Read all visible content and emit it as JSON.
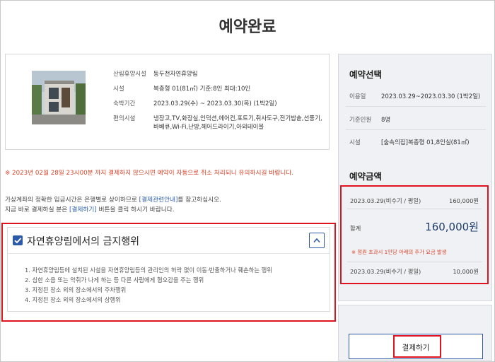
{
  "page": {
    "title": "예약완료"
  },
  "facility": {
    "photo_icon": "house-photo",
    "rows": [
      {
        "label": "산림휴양시설",
        "value": "동두천자연휴양림"
      },
      {
        "label": "시설",
        "value": "복층형 01(81㎡) 기준:8인 최대:10인"
      },
      {
        "label": "숙박기간",
        "value": "2023.03.29(수) ~ 2023.03.30(목) (1박2일)"
      },
      {
        "label": "편의시설",
        "value": "냉장고,TV,화장실,인덕션,에어컨,포트기,취사도구,전기밥솥,선풍기,바베큐,Wi-Fi,난방,헤어드라이기,아외테이블"
      }
    ]
  },
  "notice": {
    "deadline": "※ 2023년 02월 28일 23시00분 까지 결제하지 않으시면 예약이 자동으로 취소 처리되니 유의하시길 바랍니다.",
    "line1_pre": "가상계좌의 정확한 입금시간은 은행별로 상이하므로 ",
    "line1_link": "[결제관련안내]",
    "line1_post": "를 참고하십시오.",
    "line2_pre": "지금 바로 결제하실 분은 ",
    "line2_link": "[결제하기]",
    "line2_post": " 버튼을 클릭 하시기 바랍니다."
  },
  "prohibited": {
    "title": "자연휴양림에서의 금지행위",
    "items": [
      "1. 자연휴양림등에 설치된 시설을 자연휴양림등의 관리인의 허락 없이 이동·반출하거나 훼손하는 행위",
      "2. 심한 소음 또는 악취가 나게 하는 등 다른 사람에게 혐오감을 주는 행위",
      "3. 지정된 장소 외의 장소에서의 주차행위",
      "4. 지정된 장소 외의 장소에서의 상행위"
    ]
  },
  "selection": {
    "title": "예약선택",
    "rows": [
      {
        "label": "이용일",
        "value": "2023.03.29~2023.03.30 (1박2일)"
      },
      {
        "label": "기준인원",
        "value": "8명"
      },
      {
        "label": "시설",
        "value": "[숲속의집]복층형 01,8인실(81㎡)"
      }
    ]
  },
  "amount": {
    "title": "예약금액",
    "line1_date": "2023.03.29(비수기 / 평일)",
    "line1_price": "160,000원",
    "total_label": "합계",
    "total_value": "160,000원",
    "surcharge_note": "※ 정원 초과시 1인당 아래의 추가 요금 발생",
    "extra_date": "2023.03.29(비수기 / 평일)",
    "extra_price": "10,000원"
  },
  "actions": {
    "pay_label": "결제하기"
  },
  "colors": {
    "accent": "#2d5aa6",
    "warning": "#d9452b",
    "highlight": "#e0141e"
  }
}
